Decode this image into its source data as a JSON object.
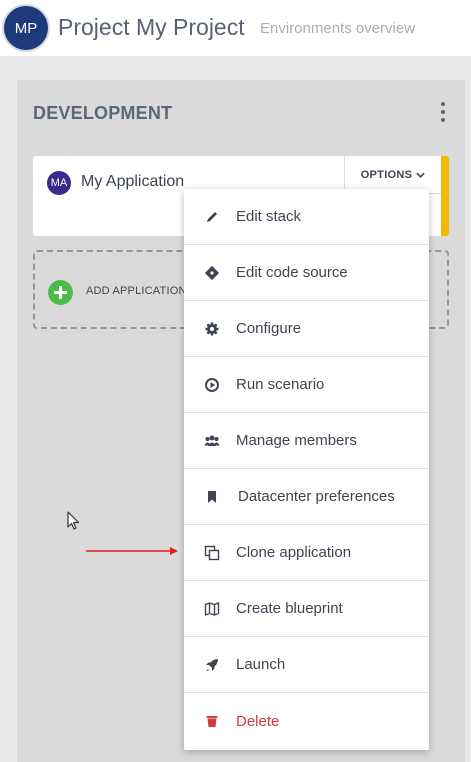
{
  "header": {
    "avatar_initials": "MP",
    "title": "Project My Project",
    "subtitle": "Environments overview"
  },
  "environment": {
    "title": "DEVELOPMENT",
    "menu_icon": "vertical-dots-icon"
  },
  "application": {
    "avatar_initials": "MA",
    "name": "My Application",
    "options_label": "OPTIONS",
    "status_color": "#f5b800"
  },
  "add_application": {
    "label": "ADD APPLICATION",
    "icon": "plus-circle-icon"
  },
  "options_menu": {
    "items": [
      {
        "label": "Edit stack",
        "icon": "pencil-icon"
      },
      {
        "label": "Edit code source",
        "icon": "git-icon"
      },
      {
        "label": "Configure",
        "icon": "gear-icon"
      },
      {
        "label": "Run scenario",
        "icon": "play-circle-icon"
      },
      {
        "label": "Manage members",
        "icon": "users-icon"
      },
      {
        "label": "Datacenter preferences",
        "icon": "bookmark-icon"
      },
      {
        "label": "Clone application",
        "icon": "clone-icon"
      },
      {
        "label": "Create blueprint",
        "icon": "map-icon"
      },
      {
        "label": "Launch",
        "icon": "rocket-icon"
      },
      {
        "label": "Delete",
        "icon": "trash-icon",
        "danger": true
      }
    ]
  },
  "colors": {
    "accent": "#1f3a7a",
    "danger": "#d63a3a",
    "add": "#4cbb4a",
    "annotation_arrow": "#e02020"
  }
}
